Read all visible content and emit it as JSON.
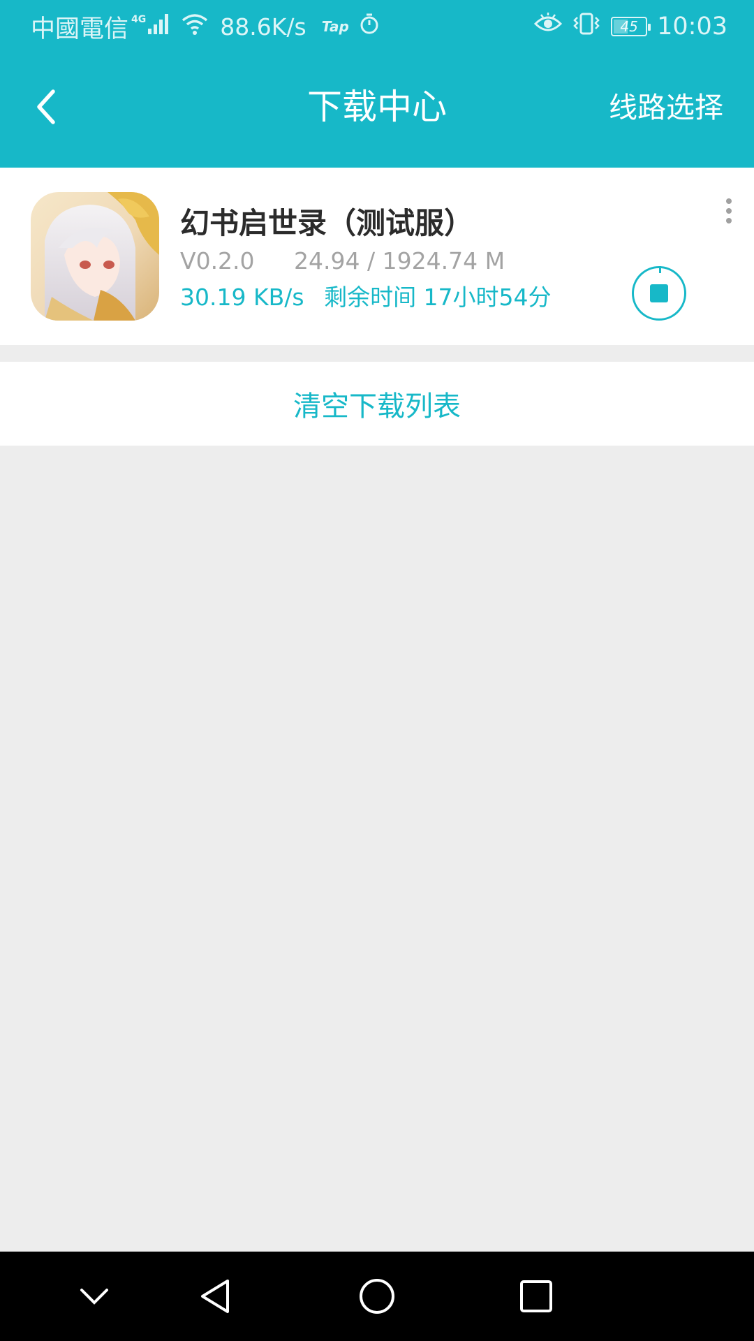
{
  "status_bar": {
    "carrier": "中國電信",
    "network_type": "4G",
    "net_speed": "88.6K/s",
    "tap_label": "Tap",
    "battery_level": "45",
    "battery_fraction": 0.45,
    "time": "10:03",
    "icons": [
      "signal-icon",
      "wifi-icon",
      "tap-icon",
      "timer-icon",
      "eye-icon",
      "vibrate-icon",
      "battery-icon"
    ]
  },
  "header": {
    "back_icon": "chevron-left-icon",
    "title": "下载中心",
    "route_select": "线路选择",
    "background_color": "#17b8c8"
  },
  "download": {
    "app_name": "幻书启世录（测试服）",
    "version": "V0.2.0",
    "size_progress": "24.94 / 1924.74 M",
    "speed": "30.19 KB/s",
    "remaining": "剩余时间 17小时54分",
    "progress_fraction": 0.013,
    "more_icon": "more-vertical-icon",
    "action_icon": "stop-icon",
    "accent_color": "#17b8c8"
  },
  "actions": {
    "clear_list": "清空下载列表"
  },
  "nav_bar": {
    "icons": [
      "chevron-down-icon",
      "back-triangle-icon",
      "home-circle-icon",
      "recents-square-icon"
    ]
  }
}
